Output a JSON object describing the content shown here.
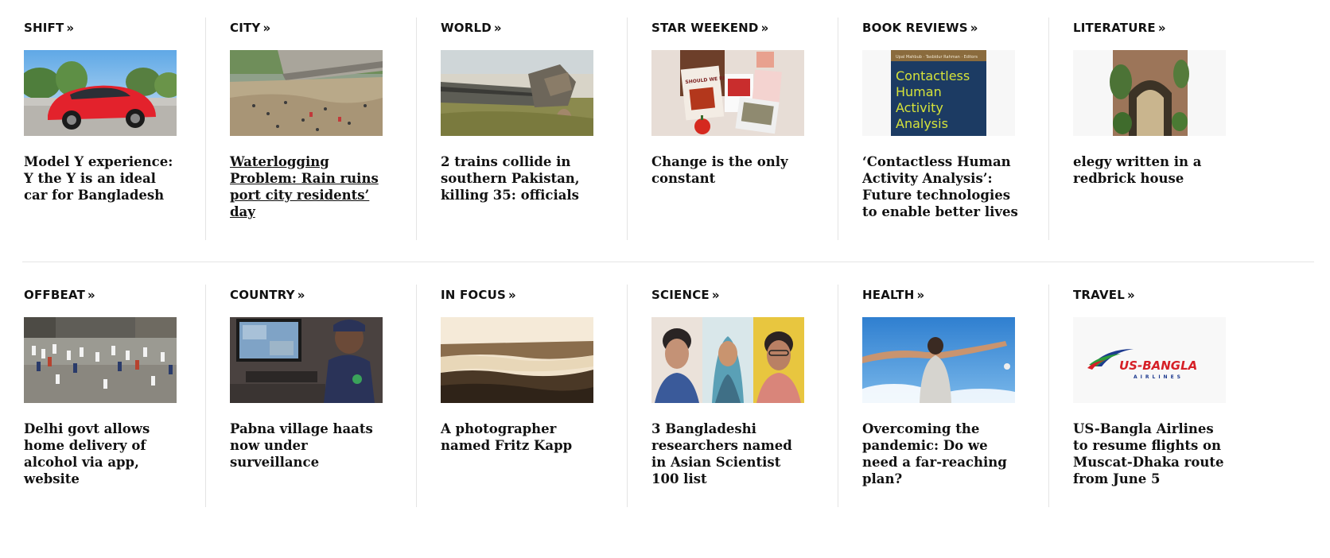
{
  "sections": [
    {
      "label": "SHIFT",
      "headline": "Model Y experience: Y the Y is an ideal car for Bangladesh",
      "image": "red-car-photo"
    },
    {
      "label": "CITY",
      "headline": "Waterlogging Problem: Rain ruins port city residents’ day",
      "image": "flooded-street-photo"
    },
    {
      "label": "WORLD",
      "headline": "2 trains collide in southern Pakistan, killing 35: officials",
      "image": "train-wreck-photo"
    },
    {
      "label": "STAR WEEKEND",
      "headline": "Change is the only constant",
      "image": "magazine-collage-photo"
    },
    {
      "label": "BOOK REVIEWS",
      "headline": "‘Contactless Human Activity Analysis’: Future technologies to enable better lives",
      "image": "book-cover-photo"
    },
    {
      "label": "LITERATURE",
      "headline": "elegy written in a redbrick house",
      "image": "arched-courtyard-photo"
    },
    {
      "label": "OFFBEAT",
      "headline": "Delhi govt allows home delivery of alcohol via app, website",
      "image": "crowd-street-photo"
    },
    {
      "label": "COUNTRY",
      "headline": "Pabna village haats now under surveillance",
      "image": "police-cctv-photo"
    },
    {
      "label": "IN FOCUS",
      "headline": "A photographer named Fritz Kapp",
      "image": "sepia-river-photo"
    },
    {
      "label": "SCIENCE",
      "headline": "3 Bangladeshi researchers named in Asian Scientist 100 list",
      "image": "three-researchers-photo"
    },
    {
      "label": "HEALTH",
      "headline": "Overcoming the pandemic: Do we need a far-reaching plan?",
      "image": "open-arms-sky-photo"
    },
    {
      "label": "TRAVEL",
      "headline": "US-Bangla Airlines to resume flights on Muscat-Dhaka route from June 5",
      "image": "usbangla-logo-image"
    }
  ],
  "chevron_glyph": "»",
  "book_cover_title": "Contactless Human Activity Analysis",
  "book_cover_authors": "Upal Mahbub · Tasbidur Rahman · Editors",
  "magazine_cover_text": "SHOULD WE RETHINK",
  "airline_logo_text": "US-BANGLA",
  "airline_logo_subtext": "AIRLINES",
  "colors": {
    "divider": "#e4e4e4",
    "text": "#111111",
    "book_cover_blue": "#1c3b63",
    "book_cover_text": "#d6e33a",
    "airline_red": "#d62027",
    "airline_blue": "#1e3b8f"
  }
}
